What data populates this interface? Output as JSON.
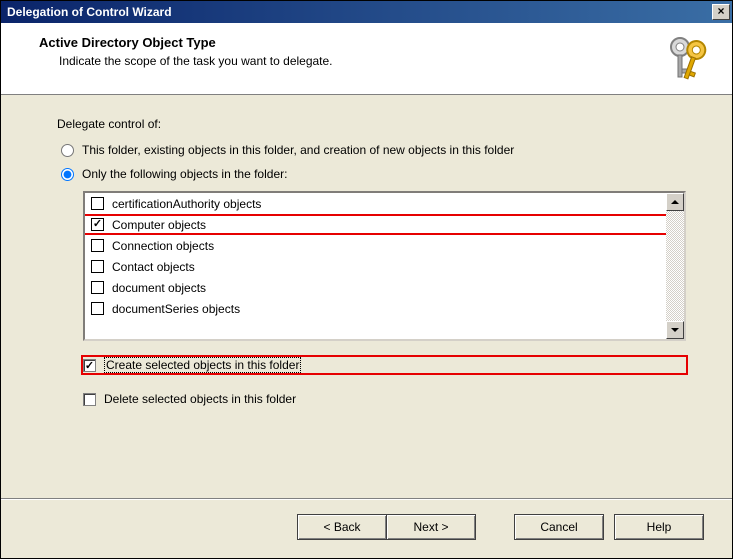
{
  "window": {
    "title": "Delegation of Control Wizard"
  },
  "header": {
    "title": "Active Directory Object Type",
    "subtitle": "Indicate the scope of the task you want to delegate."
  },
  "content": {
    "delegate_label": "Delegate control of:",
    "radio_all": "This folder, existing objects in this folder, and creation of new objects in this folder",
    "radio_only": "Only the following objects in the folder:",
    "radio_selected": "only",
    "object_types": [
      {
        "label": "certificationAuthority objects",
        "checked": false,
        "highlight": false
      },
      {
        "label": "Computer objects",
        "checked": true,
        "highlight": true
      },
      {
        "label": "Connection objects",
        "checked": false,
        "highlight": false
      },
      {
        "label": "Contact objects",
        "checked": false,
        "highlight": false
      },
      {
        "label": "document objects",
        "checked": false,
        "highlight": false
      },
      {
        "label": "documentSeries objects",
        "checked": false,
        "highlight": false
      }
    ],
    "create_label": "Create selected objects in this folder",
    "create_checked": true,
    "create_highlight": true,
    "delete_label": "Delete selected objects in this folder",
    "delete_checked": false
  },
  "footer": {
    "back": "< Back",
    "next": "Next >",
    "cancel": "Cancel",
    "help": "Help"
  }
}
